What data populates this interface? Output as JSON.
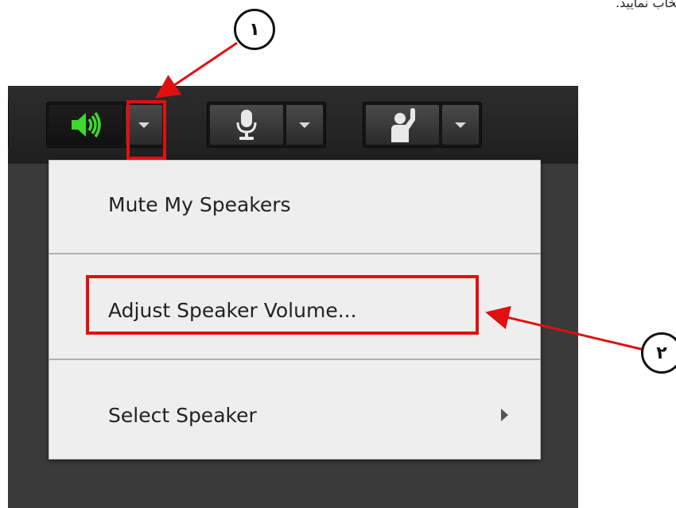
{
  "top_text": "نتخاب نمایید.",
  "toolbar": {
    "speaker_icon": "speaker-icon",
    "mic_icon": "microphone-icon",
    "raise_hand_icon": "raise-hand-icon",
    "dropdown_icon": "dropdown-triangle-icon"
  },
  "menu": {
    "items": [
      {
        "label": "Mute My Speakers"
      },
      {
        "label": "Adjust Speaker Volume..."
      },
      {
        "label": "Select Speaker",
        "submenu": true
      }
    ]
  },
  "callouts": {
    "one": "۱",
    "two": "۲"
  },
  "colors": {
    "highlight": "#e01010",
    "speaker_active": "#3dd92c",
    "menu_bg": "#eeeeee",
    "app_bg": "#3a3a3a"
  }
}
